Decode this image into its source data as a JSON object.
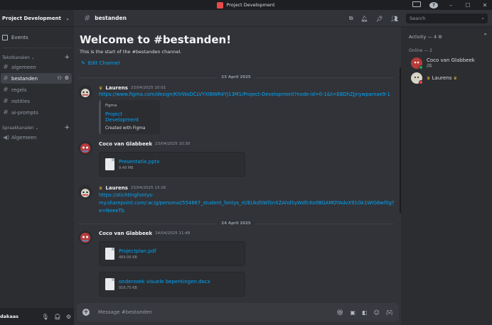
{
  "window": {
    "title": "Project Development"
  },
  "sidebar": {
    "server_name": "Project Development",
    "events_label": "Events",
    "text_category": "Tekstkanalen",
    "voice_category": "Spraakkanalen",
    "text_channels": [
      {
        "label": "algemeen"
      },
      {
        "label": "bestanden"
      },
      {
        "label": "regels"
      },
      {
        "label": "notities"
      },
      {
        "label": "ai-prompts"
      }
    ],
    "voice_channels": [
      {
        "label": "Algemeen"
      }
    ],
    "username": "dakaas"
  },
  "header": {
    "channel": "bestanden",
    "search_placeholder": "Search"
  },
  "chat": {
    "welcome_title": "Welcome to #bestanden!",
    "welcome_sub": "This is the start of the #bestanden channel.",
    "edit_channel": "Edit Channel",
    "date1": "23 April 2025",
    "date2": "24 April 2025",
    "messages": [
      {
        "author": "Laurens",
        "time": "23/04/2025 10:01",
        "link": "https://www.figma.com/design/KIVWaDCLVYXIBWR4YJ13M1/Project-Development?node-id=0-1&t=EBDhZJjnywpamae9-1",
        "embed_provider": "Figma",
        "embed_title": "Project Development",
        "embed_desc": "Created with Figma"
      },
      {
        "author": "Coco van Glabbeek",
        "time": "23/04/2025 10:30",
        "file_name": "Presentatie.pptx",
        "file_size": "9.48 MB"
      },
      {
        "author": "Laurens",
        "time": "23/04/2025 13:16",
        "link_line1": "https://stichtingfontys-",
        "link_line2": "my.sharepoint.com/:w:/g/personal/554867_student_fontys_nl/EUkdSWlSnXZAhdSyWdfcKo0BGAMOYAdvX91Gk1WiG8wf0g?",
        "link_line3": "e=NeeeTb"
      },
      {
        "author": "Coco van Glabbeek",
        "time": "24/04/2025 11:48",
        "file_name": "Projectplan.pdf",
        "file_size": "469.06 KB",
        "file2_name": "onderzoek visuele beperkingen.docx",
        "file2_size": "916.75 KB"
      }
    ],
    "composer_placeholder": "Message #bestanden"
  },
  "members": {
    "activity_label": "Activity — 4",
    "online_label": "Online — 2",
    "list": [
      {
        "name": "Coco van Glabbeek",
        "status_color": "#23a55a"
      },
      {
        "name": "Laurens",
        "status_color": "#f23f43"
      }
    ]
  },
  "colors": {
    "link": "#00a8fc",
    "crown": "#f0b232",
    "online": "#23a55a",
    "dnd": "#f23f43"
  }
}
